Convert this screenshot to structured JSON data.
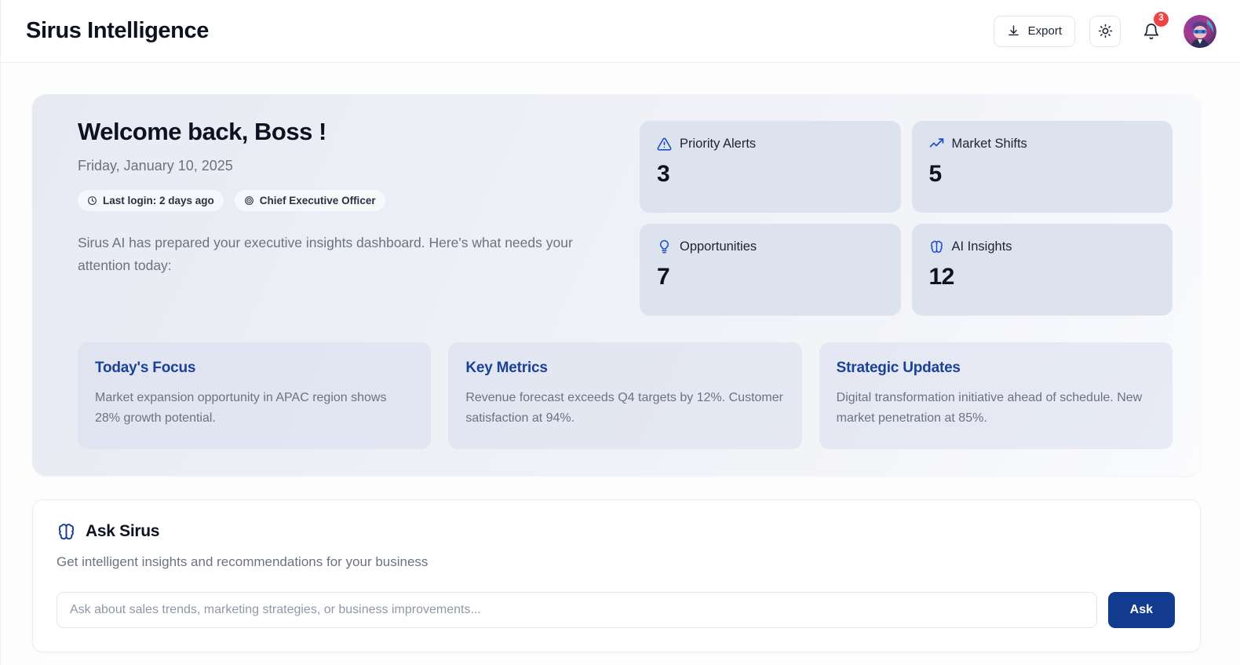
{
  "header": {
    "brand": "Sirus Intelligence",
    "export_label": "Export",
    "export_icon": "download-icon",
    "theme_icon": "sun-icon",
    "notifications_icon": "bell-icon",
    "notification_count": "3",
    "avatar_icon": "user-avatar"
  },
  "welcome": {
    "title": "Welcome back, Boss !",
    "date": "Friday, January 10, 2025",
    "pills": [
      {
        "icon": "clock-icon",
        "label": "Last login: 2 days ago"
      },
      {
        "icon": "target-icon",
        "label": "Chief Executive Officer"
      }
    ],
    "description": "Sirus AI has prepared your executive insights dashboard. Here's what needs your attention today:",
    "stats": [
      {
        "icon": "alert-triangle-icon",
        "label": "Priority Alerts",
        "value": "3"
      },
      {
        "icon": "trending-up-icon",
        "label": "Market Shifts",
        "value": "5"
      },
      {
        "icon": "lightbulb-icon",
        "label": "Opportunities",
        "value": "7"
      },
      {
        "icon": "brain-icon",
        "label": "AI Insights",
        "value": "12"
      }
    ],
    "panels": [
      {
        "title": "Today's Focus",
        "text": "Market expansion opportunity in APAC region shows 28% growth potential."
      },
      {
        "title": "Key Metrics",
        "text": "Revenue forecast exceeds Q4 targets by 12%. Customer satisfaction at 94%."
      },
      {
        "title": "Strategic Updates",
        "text": "Digital transformation initiative ahead of schedule. New market penetration at 85%."
      }
    ]
  },
  "ask": {
    "icon": "brain-icon",
    "title": "Ask Sirus",
    "subtitle": "Get intelligent insights and recommendations for your business",
    "input_placeholder": "Ask about sales trends, marketing strategies, or business improvements...",
    "input_value": "",
    "button_label": "Ask"
  },
  "colors": {
    "accent_blue": "#1a4196",
    "button_blue": "#123a8f",
    "badge_red": "#ef4444",
    "stat_card_bg": "#dde2ef",
    "muted_text": "#6b7280"
  }
}
